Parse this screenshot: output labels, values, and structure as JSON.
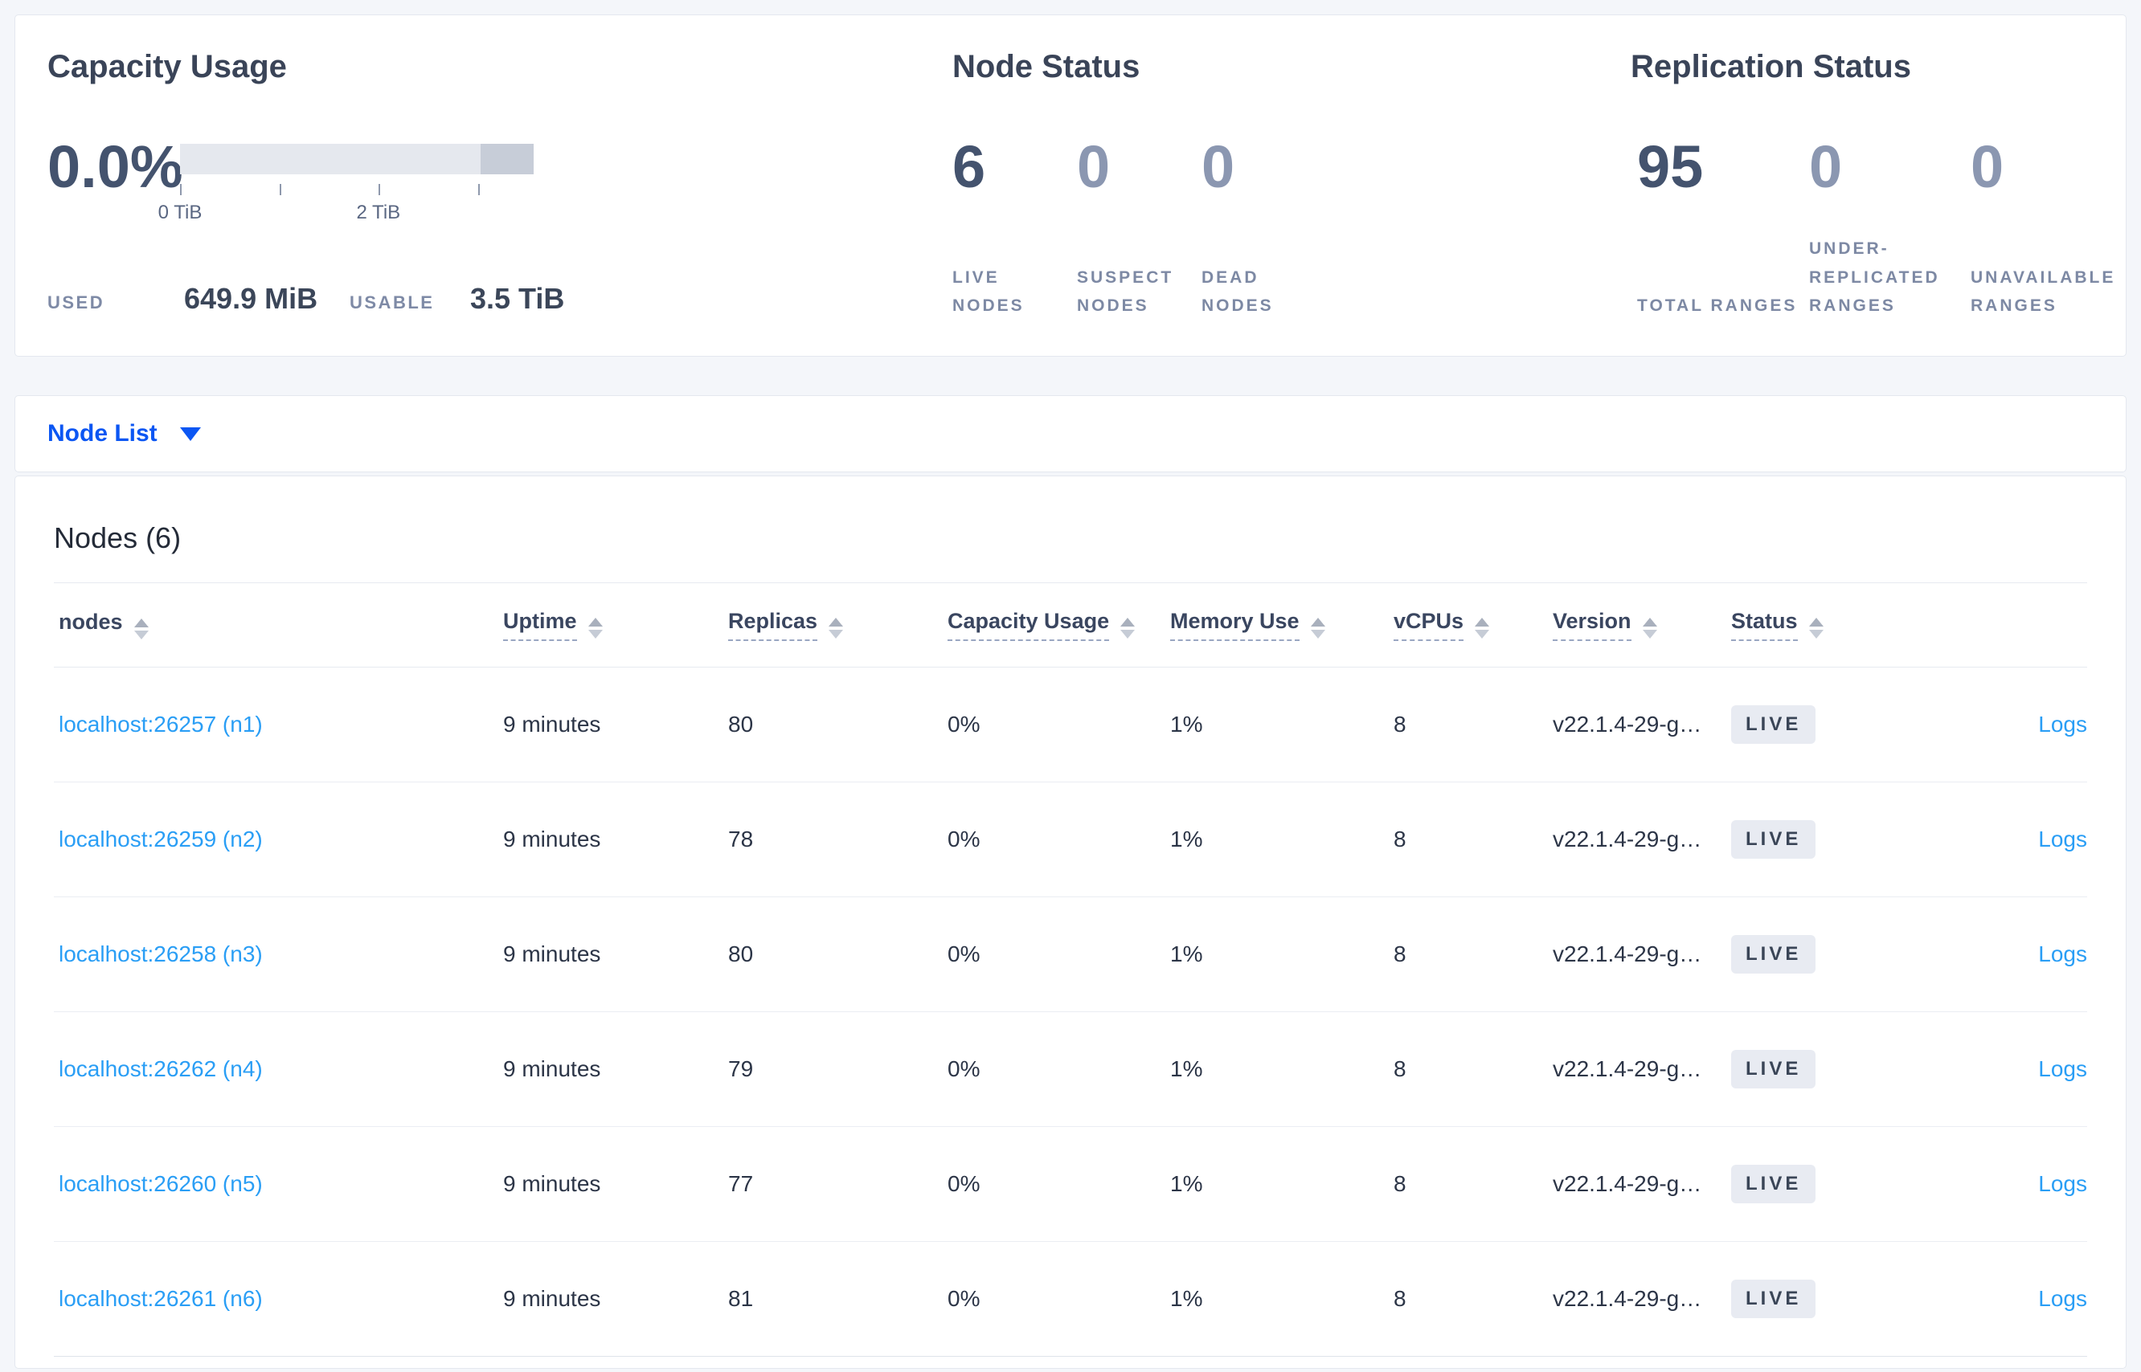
{
  "colors": {
    "page_bg": "#f4f6fa",
    "accent_blue": "#0b56f3",
    "link_blue": "#2a9ef5",
    "heading": "#3a4458",
    "muted_label": "#7d89a4",
    "value_dark": "#44536e",
    "value_light": "#8b97b1",
    "badge_bg": "#e8ebf2",
    "bar_light": "#e5e8ee",
    "bar_dark": "#c7cdd8"
  },
  "summary": {
    "capacity": {
      "title": "Capacity Usage",
      "percent": "0.0%",
      "tick_labels": [
        "0 TiB",
        "2 TiB"
      ],
      "used_label": "USED",
      "used_value": "649.9 MiB",
      "usable_label": "USABLE",
      "usable_value": "3.5 TiB"
    },
    "node_status": {
      "title": "Node Status",
      "metrics": [
        {
          "value": "6",
          "label": "LIVE NODES"
        },
        {
          "value": "0",
          "label": "SUSPECT NODES"
        },
        {
          "value": "0",
          "label": "DEAD NODES"
        }
      ]
    },
    "replication_status": {
      "title": "Replication Status",
      "metrics": [
        {
          "value": "95",
          "label": "TOTAL RANGES"
        },
        {
          "value": "0",
          "label": "UNDER-REPLICATED RANGES"
        },
        {
          "value": "0",
          "label": "UNAVAILABLE RANGES"
        }
      ]
    }
  },
  "view_selector": {
    "label": "Node List"
  },
  "nodes_table": {
    "title": "Nodes (6)",
    "columns": [
      "nodes",
      "Uptime",
      "Replicas",
      "Capacity Usage",
      "Memory Use",
      "vCPUs",
      "Version",
      "Status"
    ],
    "rows": [
      {
        "node": "localhost:26257 (n1)",
        "uptime": "9 minutes",
        "replicas": "80",
        "capacity_usage": "0%",
        "memory_use": "1%",
        "vcpus": "8",
        "version": "v22.1.4-29-g…",
        "status": "LIVE",
        "logs": "Logs"
      },
      {
        "node": "localhost:26259 (n2)",
        "uptime": "9 minutes",
        "replicas": "78",
        "capacity_usage": "0%",
        "memory_use": "1%",
        "vcpus": "8",
        "version": "v22.1.4-29-g…",
        "status": "LIVE",
        "logs": "Logs"
      },
      {
        "node": "localhost:26258 (n3)",
        "uptime": "9 minutes",
        "replicas": "80",
        "capacity_usage": "0%",
        "memory_use": "1%",
        "vcpus": "8",
        "version": "v22.1.4-29-g…",
        "status": "LIVE",
        "logs": "Logs"
      },
      {
        "node": "localhost:26262 (n4)",
        "uptime": "9 minutes",
        "replicas": "79",
        "capacity_usage": "0%",
        "memory_use": "1%",
        "vcpus": "8",
        "version": "v22.1.4-29-g…",
        "status": "LIVE",
        "logs": "Logs"
      },
      {
        "node": "localhost:26260 (n5)",
        "uptime": "9 minutes",
        "replicas": "77",
        "capacity_usage": "0%",
        "memory_use": "1%",
        "vcpus": "8",
        "version": "v22.1.4-29-g…",
        "status": "LIVE",
        "logs": "Logs"
      },
      {
        "node": "localhost:26261 (n6)",
        "uptime": "9 minutes",
        "replicas": "81",
        "capacity_usage": "0%",
        "memory_use": "1%",
        "vcpus": "8",
        "version": "v22.1.4-29-g…",
        "status": "LIVE",
        "logs": "Logs"
      }
    ]
  }
}
